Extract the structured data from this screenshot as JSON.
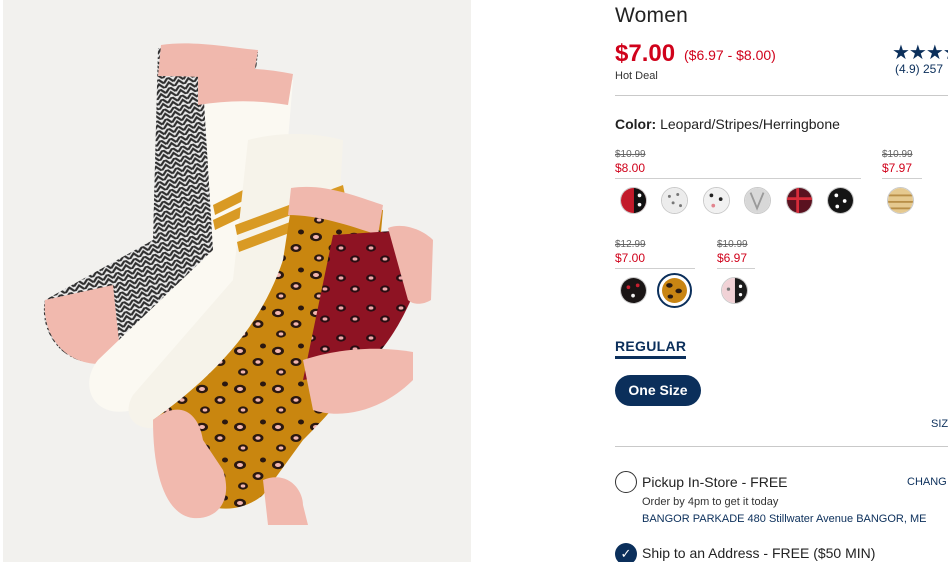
{
  "product": {
    "title": "Women",
    "price": "$7.00",
    "price_range": "($6.97 - $8.00)",
    "deal_label": "Hot Deal"
  },
  "rating": {
    "stars_value": 4.9,
    "stars_glyphs": "★★★★★",
    "text": "(4.9) 257"
  },
  "color": {
    "label": "Color:",
    "value": "Leopard/Stripes/Herringbone",
    "groups": [
      {
        "original": "$10.99",
        "sale": "$8.00"
      },
      {
        "original": "$10.99",
        "sale": "$7.97"
      },
      {
        "original": "$12.99",
        "sale": "$7.00"
      },
      {
        "original": "$10.99",
        "sale": "$6.97"
      }
    ],
    "swatches": [
      {
        "name": "red-pattern",
        "base": "#c21a2a",
        "accent": "#111111"
      },
      {
        "name": "white-dots",
        "base": "#ececec",
        "accent": "#777777"
      },
      {
        "name": "white-hearts",
        "base": "#f1f1f1",
        "accent": "#222222"
      },
      {
        "name": "grey-pattern",
        "base": "#d8d8d8",
        "accent": "#9a9a9a"
      },
      {
        "name": "maroon-plaid",
        "base": "#5a1220",
        "accent": "#d92c3a"
      },
      {
        "name": "black-white-dots",
        "base": "#151515",
        "accent": "#ffffff"
      },
      {
        "name": "tan-stripes",
        "base": "#e5c98f",
        "accent": "#b88f48"
      },
      {
        "name": "black-red-dots",
        "base": "#1a1515",
        "accent": "#c81f2f"
      },
      {
        "name": "leopard",
        "base": "#c98513",
        "accent": "#2a1a12"
      },
      {
        "name": "pink-black-dots",
        "base": "#f1d2d6",
        "accent": "#1b1b1b"
      }
    ]
  },
  "fit": {
    "tab_label": "REGULAR",
    "size_label": "One Size",
    "size_chart_label": "SIZ"
  },
  "fulfillment": {
    "pickup_label": "Pickup In-Store - FREE",
    "change_label": "CHANG",
    "order_by": "Order by 4pm to get it today",
    "store": "BANGOR PARKADE 480 Stillwater Avenue  BANGOR, ME",
    "ship_label": "Ship to an Address - FREE ($50 MIN)",
    "check_glyph": "✓"
  },
  "colors": {
    "navy": "#0b2f5b",
    "sale_red": "#d0021b"
  }
}
